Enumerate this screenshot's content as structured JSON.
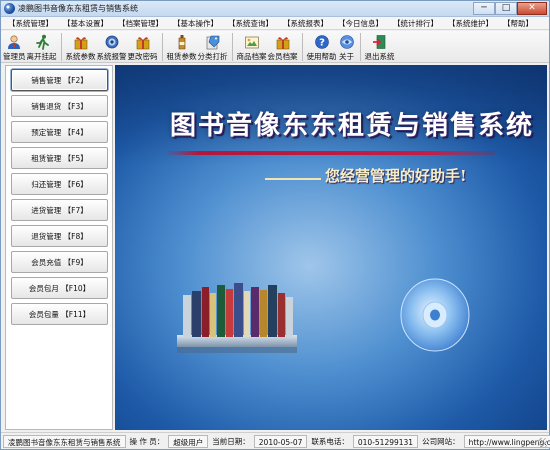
{
  "window": {
    "title": "凌鹏图书音像东东租赁与销售系统",
    "controls": [
      "─",
      "□",
      "✕"
    ]
  },
  "menu": [
    "【系统管理】",
    "【基本设置】",
    "【档案管理】",
    "【基本操作】",
    "【系统查询】",
    "【系统报表】",
    "【今日信息】",
    "【统计排行】",
    "【系统维护】",
    "【帮助】"
  ],
  "toolbar": {
    "buttons": [
      {
        "label": "管理员",
        "icon": "administrator-icon"
      },
      {
        "label": "离开挂起",
        "icon": "running-man-icon"
      },
      {
        "label": "系统参数",
        "icon": "gift-box-icon"
      },
      {
        "label": "系统报警",
        "icon": "gear-icon"
      },
      {
        "label": "更改密码",
        "icon": "gift-box-icon"
      },
      {
        "label": "租赁参数",
        "icon": "bottle-icon"
      },
      {
        "label": "分类打折",
        "icon": "price-tag-icon"
      },
      {
        "label": "商品档案",
        "icon": "photo-archive-icon"
      },
      {
        "label": "会员档案",
        "icon": "gift-box-icon"
      },
      {
        "label": "使用帮助",
        "icon": "help-icon"
      },
      {
        "label": "关于",
        "icon": "about-icon"
      },
      {
        "label": "退出系统",
        "icon": "exit-door-icon"
      }
    ]
  },
  "nav": [
    {
      "label": "销售管理 【F2】",
      "active": true
    },
    {
      "label": "销售退货 【F3】"
    },
    {
      "label": "预定管理 【F4】"
    },
    {
      "label": "租赁管理 【F5】"
    },
    {
      "label": "归还管理 【F6】"
    },
    {
      "label": "进货管理 【F7】"
    },
    {
      "label": "退货管理 【F8】"
    },
    {
      "label": "会员充值 【F9】"
    },
    {
      "label": "会员包月 【F10】"
    },
    {
      "label": "会员包量 【F11】"
    }
  ],
  "banner": {
    "title": "图书音像东东租赁与销售系统",
    "slogan": "您经营管理的好助手!"
  },
  "status": {
    "app_name": "凌鹏图书音像东东租赁与销售系统",
    "operator_label": "操 作 员：",
    "operator_value": "超级用户",
    "date_label": "当前日期：",
    "date_value": "2010-05-07",
    "phone_label": "联系电话：",
    "phone_value": "010-51299131",
    "site_label": "公司网站：",
    "site_value": "http://www.lingpeng.cn"
  },
  "colors": {
    "banner_blue": "#1e5aa8",
    "title_rule_red": "#c51d45",
    "slogan_cream": "#f7edc6"
  }
}
